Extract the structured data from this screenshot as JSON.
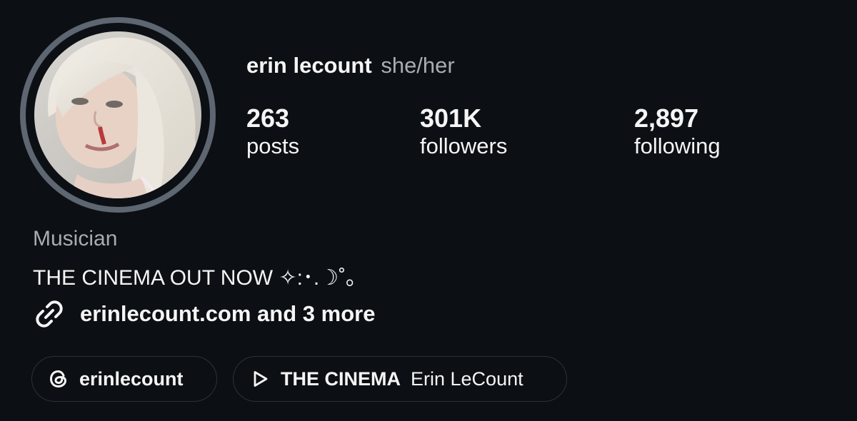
{
  "profile": {
    "name": "erin lecount",
    "pronouns": "she/her",
    "avatar_icon": "profile-photo"
  },
  "stats": [
    {
      "value": "263",
      "label": "posts"
    },
    {
      "value": "301K",
      "label": "followers"
    },
    {
      "value": "2,897",
      "label": "following"
    }
  ],
  "bio": {
    "category": "Musician",
    "text": "THE CINEMA OUT NOW ✧:･.☽˚｡"
  },
  "link": {
    "icon": "link-icon",
    "text": "erinlecount.com and 3 more"
  },
  "chips": {
    "threads": {
      "icon": "threads-icon",
      "label": "erinlecount"
    },
    "music": {
      "icon": "play-icon",
      "title": "THE CINEMA",
      "artist": "Erin LeCount"
    }
  },
  "colors": {
    "background": "#0c1014",
    "text": "#f5f5f5",
    "secondary_text": "#a8adb4",
    "avatar_ring": "#5d6671",
    "chip_border": "#2c3238"
  }
}
